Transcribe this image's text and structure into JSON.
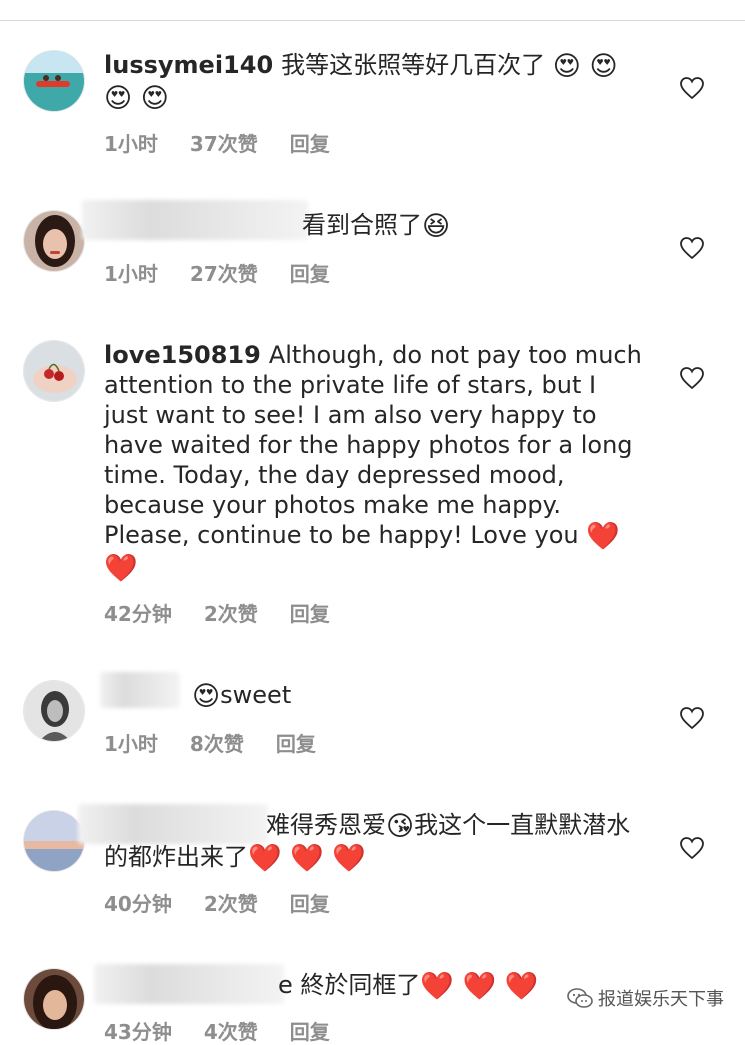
{
  "comments": [
    {
      "username": "lussymei140",
      "text": "我等这张照等好几百次了",
      "emojis_inline": "😍 😍",
      "emojis_wrap": "😍 😍",
      "time": "1小时",
      "likes": "37次赞",
      "reply": "回复",
      "avatar": "beach-boat-avatar"
    },
    {
      "username": "",
      "text": "看到合照了",
      "emojis_inline": "😆",
      "time": "1小时",
      "likes": "27次赞",
      "reply": "回复",
      "avatar": "woman-portrait-avatar"
    },
    {
      "username": "love150819",
      "text": "Although, do not pay too much attention to the private life of stars, but I just want to see! I am also very happy to have waited for the happy photos for a long time. Today, the day depressed mood, because your photos make me happy. Please, continue to be happy! Love you",
      "emojis_inline": "❤️",
      "emojis_wrap": "❤️",
      "time": "42分钟",
      "likes": "2次赞",
      "reply": "回复",
      "avatar": "hands-cherries-avatar"
    },
    {
      "username": "",
      "text": "sweet",
      "emojis_inline": "😍",
      "time": "1小时",
      "likes": "8次赞",
      "reply": "回复",
      "avatar": "grayscale-woman-avatar"
    },
    {
      "username": "",
      "text": "难得秀恩爱",
      "emojis_inline": "😘",
      "text2": "我这个一直默默潜水的都炸出来了",
      "emojis_wrap": "❤️ ❤️ ❤️",
      "time": "40分钟",
      "likes": "2次赞",
      "reply": "回复",
      "avatar": "sunset-sea-avatar"
    },
    {
      "username": "",
      "text": "e 終於同框了",
      "emojis_inline": "❤️ ❤️ ❤️",
      "time": "43分钟",
      "likes": "4次赞",
      "reply": "回复",
      "avatar": "woman-dark-hair-avatar"
    }
  ],
  "watermark": {
    "text": "报道娱乐天下事",
    "icon": "wechat-icon"
  },
  "colors": {
    "text": "#262626",
    "meta": "#8e8e8e",
    "heart_outline": "#262626",
    "divider": "#dbdbdb"
  }
}
